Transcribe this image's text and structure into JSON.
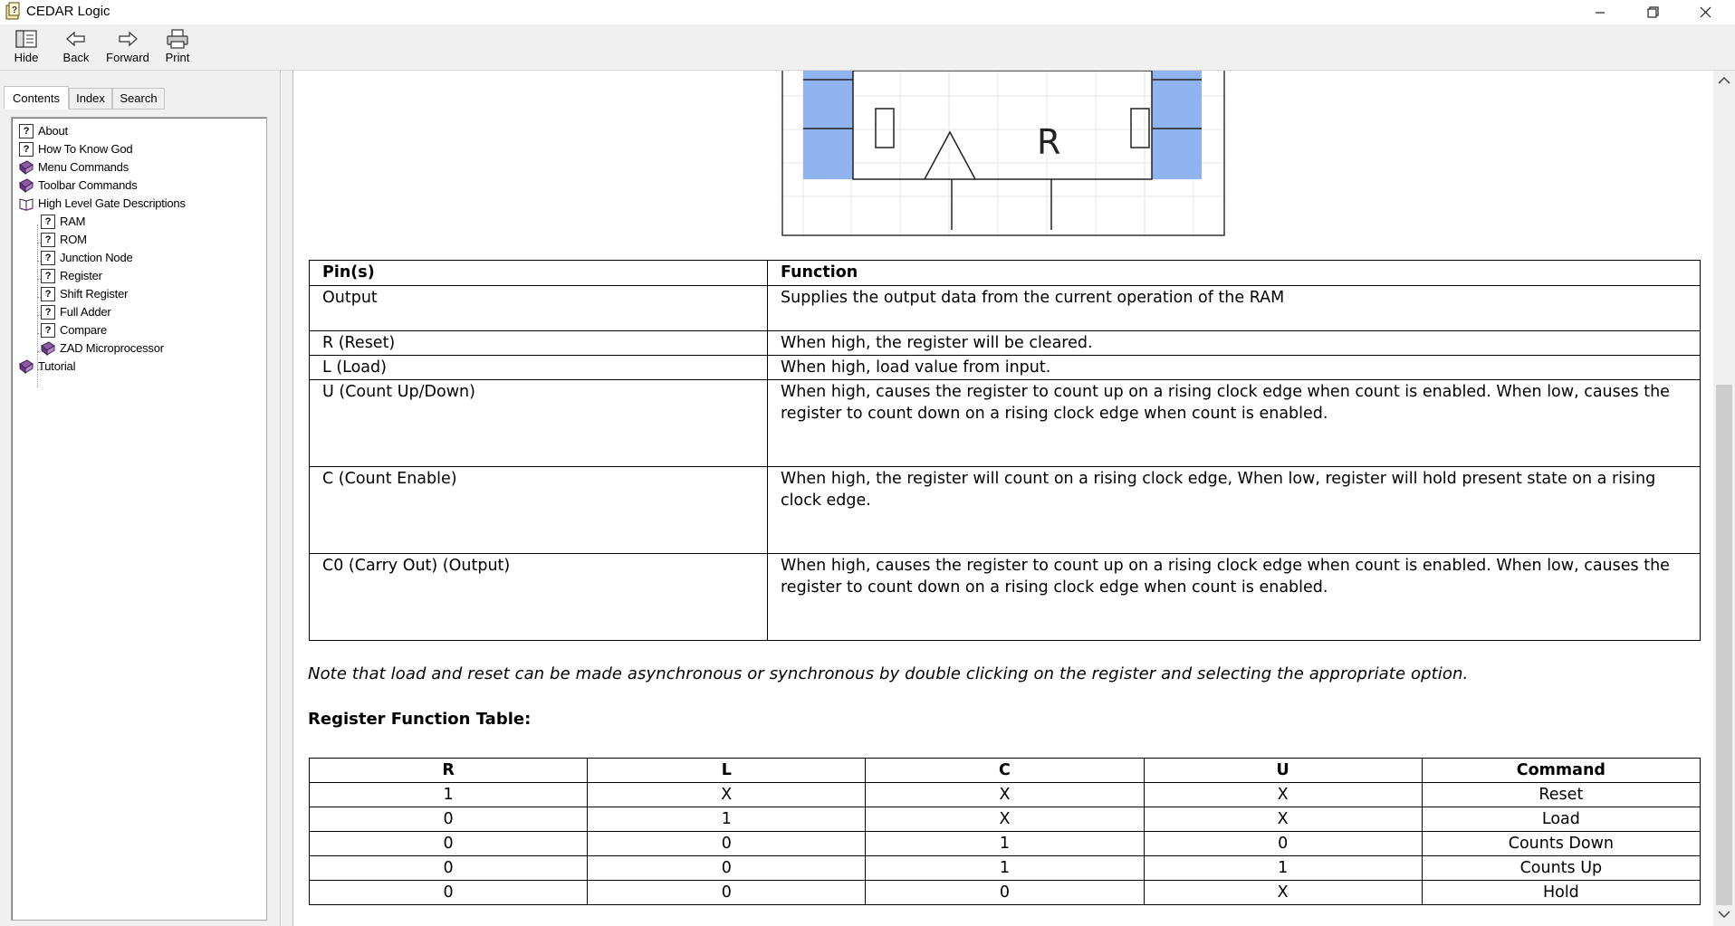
{
  "window": {
    "title": "CEDAR Logic",
    "minimize": "—",
    "restore": "❐",
    "close": "✕"
  },
  "toolbar": {
    "hide": "Hide",
    "back": "Back",
    "forward": "Forward",
    "print": "Print"
  },
  "nav_tabs": [
    "Contents",
    "Index",
    "Search"
  ],
  "tree": [
    {
      "label": "About",
      "icon": "help-page-icon"
    },
    {
      "label": "How To Know God",
      "icon": "help-page-icon"
    },
    {
      "label": "Menu Commands",
      "icon": "book-closed-icon"
    },
    {
      "label": "Toolbar Commands",
      "icon": "book-closed-icon"
    },
    {
      "label": "High Level Gate Descriptions",
      "icon": "book-open-icon"
    },
    {
      "label": "RAM",
      "icon": "help-page-icon"
    },
    {
      "label": "ROM",
      "icon": "help-page-icon"
    },
    {
      "label": "Junction Node",
      "icon": "help-page-icon"
    },
    {
      "label": "Register",
      "icon": "help-page-icon"
    },
    {
      "label": "Shift Register",
      "icon": "help-page-icon"
    },
    {
      "label": "Full Adder",
      "icon": "help-page-icon"
    },
    {
      "label": "Compare",
      "icon": "help-page-icon"
    },
    {
      "label": "ZAD Microprocessor",
      "icon": "book-closed-icon"
    },
    {
      "label": "Tutorial",
      "icon": "book-closed-icon"
    }
  ],
  "diagram": {
    "reset_label": "R"
  },
  "pins_table": {
    "headers": [
      "Pin(s)",
      "Function"
    ],
    "rows": [
      [
        "Output",
        "Supplies the output data from the current operation of the RAM"
      ],
      [
        "R (Reset)",
        "When high, the register will be cleared."
      ],
      [
        "L (Load)",
        "When high, load value from input."
      ],
      [
        "U (Count Up/Down)",
        "When high, causes the register to count up on a rising clock edge when count is enabled. When low, causes the register to count down on a rising clock edge when count is enabled."
      ],
      [
        "C (Count Enable)",
        "When high, the register will count on a rising clock edge, When low, register will hold present state on a rising clock edge."
      ],
      [
        "C0 (Carry Out) (Output)",
        "When high, causes the register to count up on a rising clock edge when count is enabled. When low, causes the register to count down on a rising clock edge when count is enabled."
      ]
    ]
  },
  "note": "Note that load and reset can be made asynchronous or synchronous by double clicking on the register and selecting the appropriate option.",
  "function_table": {
    "title": "Register Function Table:",
    "headers": [
      "R",
      "L",
      "C",
      "U",
      "Command"
    ],
    "rows": [
      [
        "1",
        "X",
        "X",
        "X",
        "Reset"
      ],
      [
        "0",
        "1",
        "X",
        "X",
        "Load"
      ],
      [
        "0",
        "0",
        "1",
        "0",
        "Counts Down"
      ],
      [
        "0",
        "0",
        "1",
        "1",
        "Counts Up"
      ],
      [
        "0",
        "0",
        "0",
        "X",
        "Hold"
      ]
    ]
  },
  "scrollbar": {
    "up": "∧",
    "down": "∨"
  }
}
